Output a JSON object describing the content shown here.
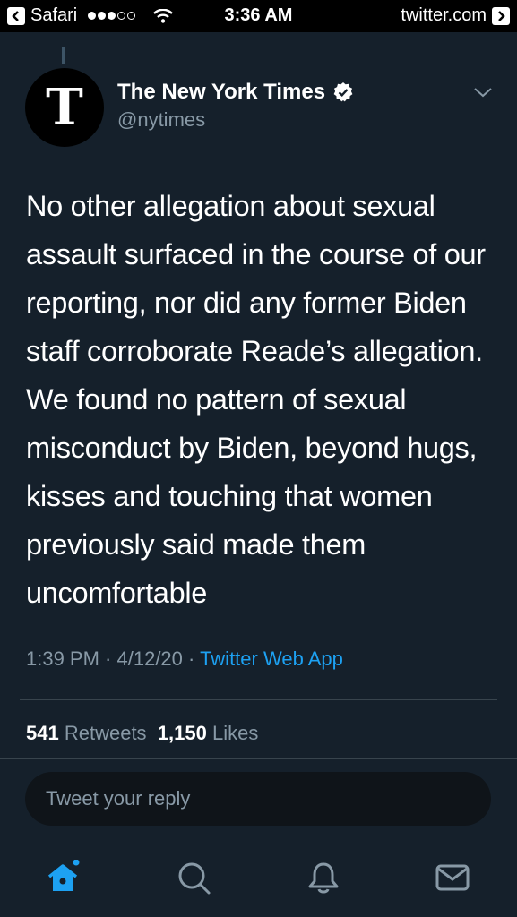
{
  "status_bar": {
    "app": "Safari",
    "time": "3:36 AM",
    "site": "twitter.com"
  },
  "tweet": {
    "author_name": "The New York Times",
    "author_handle": "@nytimes",
    "avatar_letter": "T",
    "verified": true,
    "text": "No other allegation about sexual assault surfaced in the course of our reporting, nor did any former Biden staff corroborate Reade’s allegation. We found no pattern of sexual misconduct by Biden, beyond hugs, kisses and touching that women previously said made them uncomfortable",
    "time": "1:39 PM",
    "date": "4/12/20",
    "source": "Twitter Web App",
    "separator": " · ",
    "retweet_count": "541",
    "retweet_label": "Retweets",
    "like_count": "1,150",
    "like_label": "Likes"
  },
  "reply": {
    "placeholder": "Tweet your reply"
  },
  "tabs": [
    {
      "name": "home",
      "icon": "home-icon",
      "active": true
    },
    {
      "name": "search",
      "icon": "search-icon",
      "active": false
    },
    {
      "name": "notifications",
      "icon": "bell-icon",
      "active": false
    },
    {
      "name": "messages",
      "icon": "mail-icon",
      "active": false
    }
  ],
  "colors": {
    "background": "#15202b",
    "accent": "#1da1f2",
    "secondary_text": "#8899a6",
    "divider": "#38444d"
  }
}
